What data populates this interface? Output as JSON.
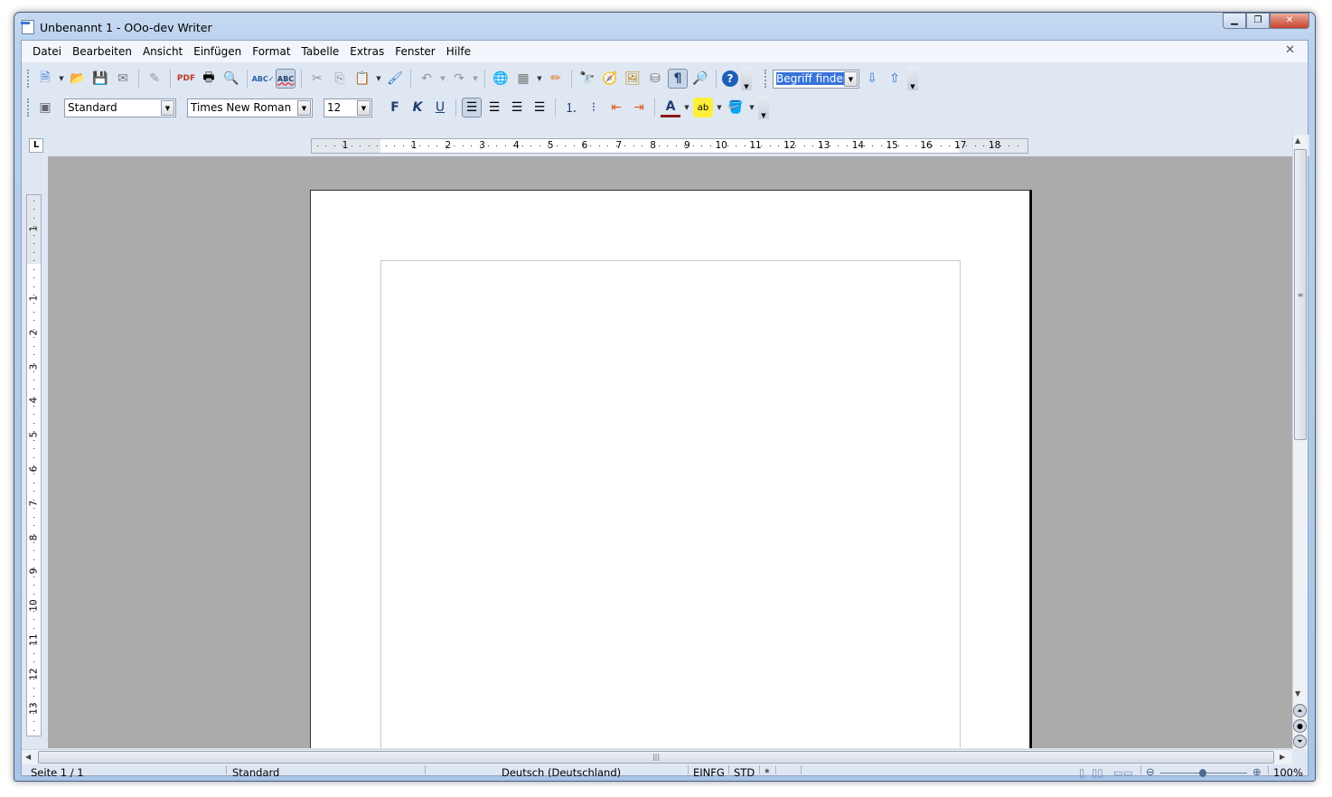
{
  "window": {
    "title": "Unbenannt 1 - OOo-dev Writer",
    "buttons": {
      "minimize": "▁",
      "maximize": "❐",
      "close": "✕"
    }
  },
  "menu": {
    "items": [
      "Datei",
      "Bearbeiten",
      "Ansicht",
      "Einfügen",
      "Format",
      "Tabelle",
      "Extras",
      "Fenster",
      "Hilfe"
    ],
    "close": "✕"
  },
  "standard_toolbar": {
    "icons": [
      "new-document",
      "open",
      "save",
      "email",
      "edit-file",
      "export-pdf",
      "print",
      "page-preview",
      "spellcheck",
      "autospellcheck",
      "cut",
      "copy",
      "paste",
      "clone-formatting",
      "undo",
      "redo",
      "hyperlink",
      "table",
      "show-draw-functions",
      "find-replace",
      "navigator",
      "gallery",
      "data-sources",
      "formatting-marks",
      "zoom",
      "help"
    ]
  },
  "find_toolbar": {
    "search_value": "Begriff finden",
    "icons": [
      "find-next",
      "find-previous"
    ]
  },
  "format_toolbar": {
    "style": "Standard",
    "font": "Times New Roman",
    "size": "12",
    "icons": [
      "bold",
      "italic",
      "underline",
      "align-left",
      "align-center",
      "align-right",
      "justify",
      "numbering",
      "bullets",
      "decrease-indent",
      "increase-indent",
      "font-color",
      "highlighting",
      "background-color"
    ],
    "bold": "F",
    "italic": "K",
    "underline": "U"
  },
  "ruler": {
    "corner": "L",
    "h_labels_left": [
      "1"
    ],
    "h_labels": [
      "1",
      "2",
      "3",
      "4",
      "5",
      "6",
      "7",
      "8",
      "9",
      "10",
      "11",
      "12",
      "13",
      "14",
      "15",
      "16",
      "17",
      "18"
    ],
    "v_labels_top": [
      "1"
    ],
    "v_labels": [
      "1",
      "2",
      "3",
      "4",
      "5",
      "6",
      "7",
      "8",
      "9",
      "10",
      "11",
      "12",
      "13"
    ]
  },
  "status": {
    "page": "Seite 1 / 1",
    "style": "Standard",
    "language": "Deutsch (Deutschland)",
    "insert_mode": "EINFG",
    "selection_mode": "STD",
    "modified": "*",
    "zoom": "100%",
    "zoom_level_percent": 100
  }
}
